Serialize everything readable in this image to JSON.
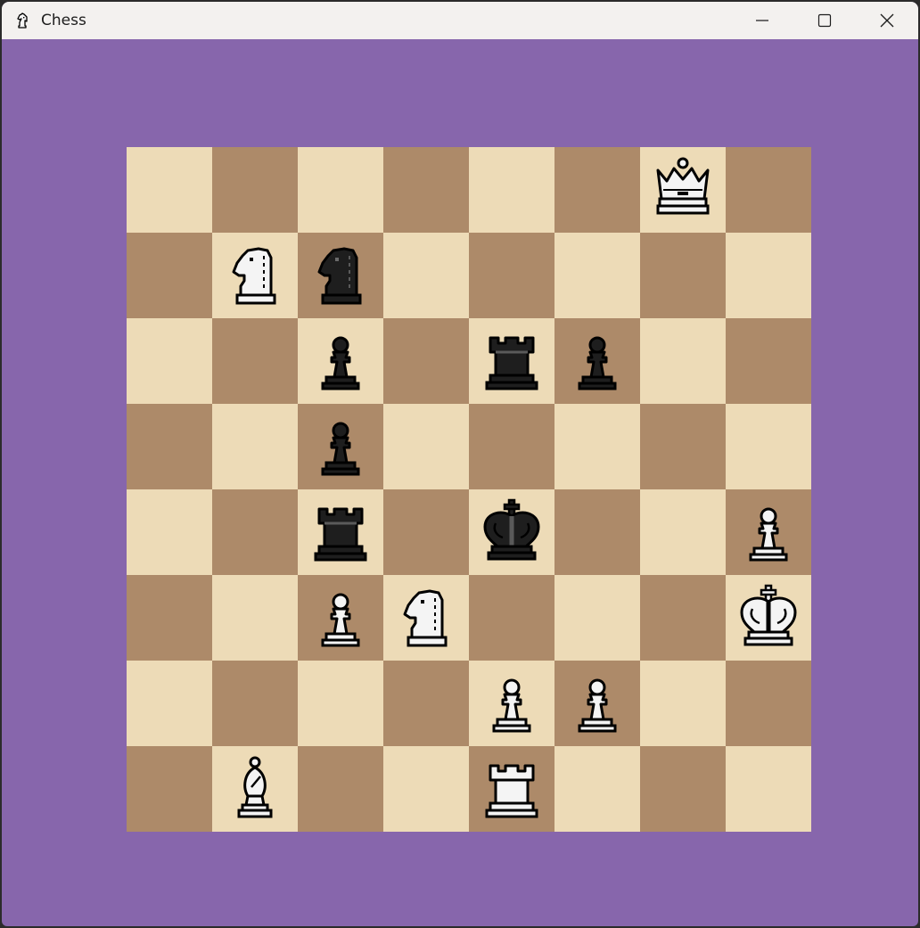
{
  "window": {
    "title": "Chess",
    "app_icon": "chess-knight-icon",
    "controls": [
      "minimize-icon",
      "maximize-icon",
      "close-icon"
    ]
  },
  "colors": {
    "background": "#8766ac",
    "light_square": "#eddbb7",
    "dark_square": "#ad8a69",
    "white_piece_fill": "#f4f4f4",
    "black_piece_fill": "#1e1e1e",
    "outline": "#000000"
  },
  "board": {
    "ranks": [
      [
        "",
        "",
        "",
        "",
        "",
        "",
        "wQ",
        ""
      ],
      [
        "",
        "wN",
        "bN",
        "",
        "",
        "",
        "",
        ""
      ],
      [
        "",
        "",
        "bP",
        "",
        "bR",
        "bP",
        "",
        ""
      ],
      [
        "",
        "",
        "bP",
        "",
        "",
        "",
        "",
        ""
      ],
      [
        "",
        "",
        "bR",
        "",
        "bK",
        "",
        "",
        "wP"
      ],
      [
        "",
        "",
        "wP",
        "wN",
        "",
        "",
        "",
        "wK"
      ],
      [
        "",
        "",
        "",
        "",
        "wP",
        "wP",
        "",
        ""
      ],
      [
        "",
        "wB",
        "",
        "",
        "wR",
        "",
        "",
        ""
      ]
    ],
    "piece_names": {
      "P": "pawn",
      "N": "knight",
      "B": "bishop",
      "R": "rook",
      "Q": "queen",
      "K": "king"
    }
  }
}
